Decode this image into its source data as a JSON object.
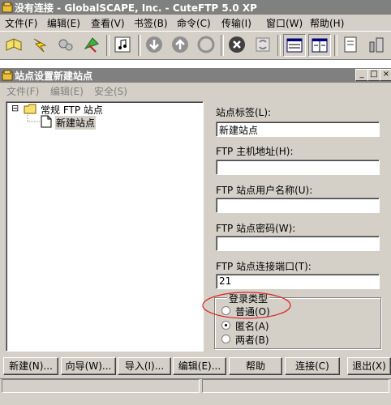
{
  "window": {
    "title": "没有连接 - GlobalSCAPE, Inc. - CuteFTP 5.0 XP"
  },
  "menu": [
    "文件(F)",
    "编辑(E)",
    "查看(V)",
    "书签(B)",
    "命令(C)",
    "传输(I)",
    "窗口(W)",
    "帮助(H)"
  ],
  "dialog": {
    "title": "站点设置新建站点",
    "menu": [
      "文件(F)",
      "编辑(E)",
      "安全(S)"
    ],
    "window_buttons": {
      "minimize": "_",
      "maximize": "□",
      "close": "×"
    },
    "tree": {
      "root": "常规 FTP 站点",
      "child": "新建站点",
      "expander": "⊟"
    },
    "fields": {
      "site_label": {
        "label": "站点标签(L):",
        "value": "新建站点"
      },
      "host": {
        "label": "FTP 主机地址(H):",
        "value": ""
      },
      "user": {
        "label": "FTP 站点用户名称(U):",
        "value": ""
      },
      "password": {
        "label": "FTP 站点密码(W):",
        "value": ""
      },
      "port": {
        "label": "FTP 站点连接端口(T):",
        "value": "21"
      }
    },
    "login_type": {
      "title": "登录类型",
      "options": [
        {
          "label": "普通(O)",
          "selected": false
        },
        {
          "label": "匿名(A)",
          "selected": true
        },
        {
          "label": "两者(B)",
          "selected": false
        }
      ]
    },
    "buttons": {
      "new": "新建(N)...",
      "wizard": "向导(W)...",
      "import": "导入(I)...",
      "edit": "编辑(E)...",
      "help": "帮助",
      "connect": "连接(C)",
      "exit": "退出(X)"
    }
  },
  "colors": {
    "face": "#d4d0c8",
    "inactive_title": "#808080",
    "annotation": "#e02020"
  }
}
